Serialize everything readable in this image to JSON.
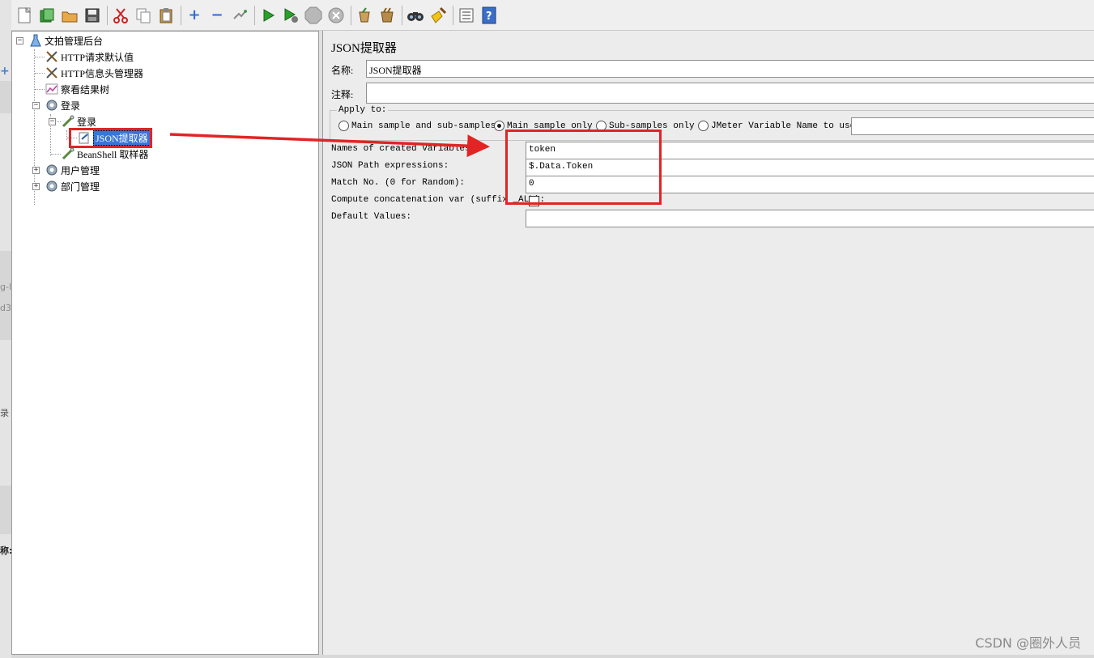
{
  "background_fragments": [
    "g-l",
    "d3",
    "录",
    "称:"
  ],
  "toolbar": {
    "icons": [
      "new-icon",
      "templates-icon",
      "open-icon",
      "save-icon",
      "cut-icon",
      "copy-icon",
      "paste-icon",
      "expand-icon",
      "collapse-icon",
      "toggle-icon",
      "start-icon",
      "start-no-pauses-icon",
      "stop-icon",
      "shutdown-icon",
      "clear-icon",
      "clear-all-icon",
      "search-icon",
      "reset-search-icon",
      "function-helper-icon",
      "help-icon"
    ]
  },
  "tree": {
    "items": [
      {
        "label": "文拍管理后台",
        "icon": "test-plan-icon"
      },
      {
        "label": "HTTP请求默认值",
        "icon": "config-element-icon"
      },
      {
        "label": "HTTP信息头管理器",
        "icon": "config-element-icon"
      },
      {
        "label": "察看结果树",
        "icon": "listener-icon"
      },
      {
        "label": "登录",
        "icon": "thread-group-icon"
      },
      {
        "label": "登录",
        "icon": "sampler-icon"
      },
      {
        "label": "JSON提取器",
        "icon": "post-processor-icon"
      },
      {
        "label": "BeanShell 取样器",
        "icon": "sampler-icon"
      },
      {
        "label": "用户管理",
        "icon": "thread-group-icon"
      },
      {
        "label": "部门管理",
        "icon": "thread-group-icon"
      }
    ]
  },
  "panel": {
    "title": "JSON提取器",
    "name_label": "名称:",
    "name_value": "JSON提取器",
    "comment_label": "注释:",
    "comment_value": "",
    "apply_to_label": "Apply to:",
    "apply_options": [
      {
        "label": "Main sample and sub-samples",
        "selected": false
      },
      {
        "label": "Main sample only",
        "selected": true
      },
      {
        "label": "Sub-samples only",
        "selected": false
      },
      {
        "label": "JMeter Variable Name to use",
        "selected": false
      }
    ],
    "jmeter_var_value": "",
    "fields": [
      {
        "label": "Names of created variables:",
        "value": "token"
      },
      {
        "label": "JSON Path expressions:",
        "value": "$.Data.Token"
      },
      {
        "label": "Match No. (0 for Random):",
        "value": "0"
      },
      {
        "label": "Compute concatenation var (suffix _ALL):",
        "checked": false
      },
      {
        "label": "Default Values:",
        "value": ""
      }
    ]
  },
  "annotation_color": "#e22424",
  "watermark": "CSDN @圈外人员"
}
